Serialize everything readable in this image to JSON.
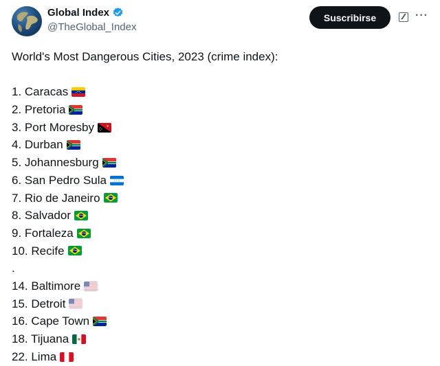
{
  "author": {
    "name": "Global Index",
    "handle": "@TheGlobal_Index",
    "verified": true,
    "avatar_icon": "globe-icon"
  },
  "actions": {
    "subscribe_label": "Suscribirse",
    "grok_icon": "grok-icon",
    "more_icon": "more-options-icon",
    "more_glyph": "···"
  },
  "post": {
    "title": "World's Most Dangerous Cities, 2023 (crime index):",
    "items": [
      {
        "label": "1. Caracas",
        "flag": "venezuela"
      },
      {
        "label": "2. Pretoria",
        "flag": "south-africa"
      },
      {
        "label": "3. Port Moresby",
        "flag": "papua-new-guinea"
      },
      {
        "label": "4. Durban",
        "flag": "south-africa"
      },
      {
        "label": "5. Johannesburg",
        "flag": "south-africa"
      },
      {
        "label": "6. San Pedro Sula",
        "flag": "honduras"
      },
      {
        "label": "7. Rio de Janeiro",
        "flag": "brazil"
      },
      {
        "label": "8. Salvador",
        "flag": "brazil"
      },
      {
        "label": "9. Fortaleza",
        "flag": "brazil"
      },
      {
        "label": "10. Recife",
        "flag": "brazil"
      },
      {
        "label": ".",
        "flag": null
      },
      {
        "label": "14. Baltimore",
        "flag": "united-states"
      },
      {
        "label": "15. Detroit",
        "flag": "united-states"
      },
      {
        "label": "16. Cape Town",
        "flag": "south-africa"
      },
      {
        "label": "18. Tijuana",
        "flag": "mexico"
      },
      {
        "label": "22. Lima",
        "flag": "peru"
      }
    ]
  }
}
